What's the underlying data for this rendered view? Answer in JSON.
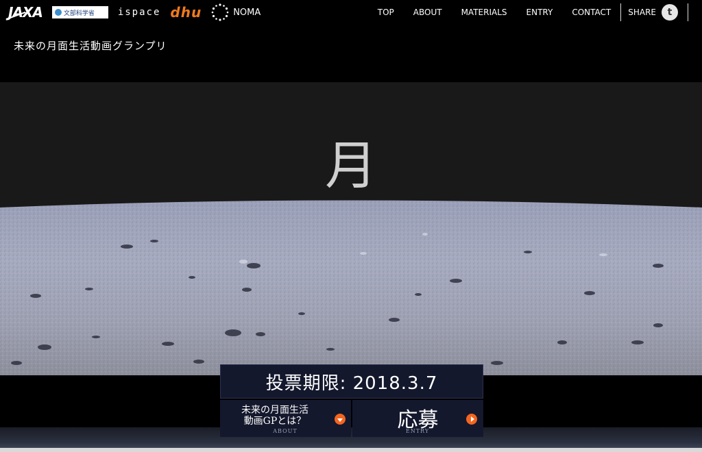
{
  "header": {
    "logos": {
      "jaxa": "JAXA",
      "mext": "文部科学省",
      "ispace": "ispace",
      "dhu": "dhu",
      "noma": "NOMA"
    },
    "site_title": "未来の月面生活動画グランプリ"
  },
  "nav": {
    "items": [
      "TOP",
      "ABOUT",
      "MATERIALS",
      "ENTRY",
      "CONTACT"
    ],
    "share_label": "SHARE",
    "share_icon": "t"
  },
  "hero": {
    "kanji": "月"
  },
  "cta": {
    "deadline": "投票期限: 2018.3.7",
    "about_line1": "未来の月面生活",
    "about_line2": "動画GPとは？",
    "about_sub": "ABOUT",
    "entry_label": "応募",
    "entry_sub": "ENTRY"
  },
  "colors": {
    "accent_orange": "#f3651f",
    "cta_navy": "#14182d",
    "dhu_orange": "#f07a1d"
  }
}
